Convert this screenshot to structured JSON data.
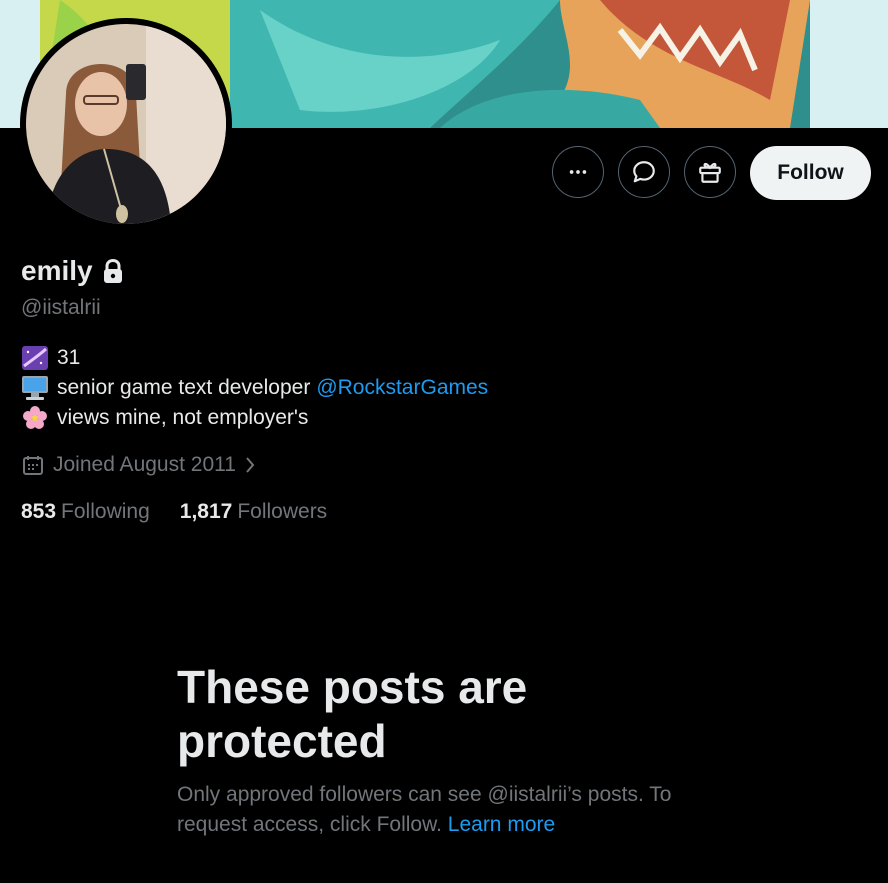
{
  "profile": {
    "display_name": "emily",
    "handle": "@iistalrii",
    "bio": {
      "line1_emoji": "milky-way-emoji",
      "line1_text": "31",
      "line2_emoji": "desktop-computer-emoji",
      "line2_text": "senior game text developer",
      "line2_mention": "@RockstarGames",
      "line3_emoji": "cherry-blossom-emoji",
      "line3_text": "views mine, not employer's"
    },
    "joined": "Joined August 2011",
    "following_count": "853",
    "following_label": "Following",
    "followers_count": "1,817",
    "followers_label": "Followers"
  },
  "actions": {
    "more_icon": "more-dots-icon",
    "message_icon": "message-bubble-icon",
    "gift_icon": "gift-icon",
    "follow_label": "Follow"
  },
  "protected": {
    "title": "These posts are protected",
    "body": "Only approved followers can see @iistalrii’s posts. To request access, click Follow.",
    "learn_more": "Learn more"
  },
  "colors": {
    "background": "#000000",
    "text_primary": "#e7e9ea",
    "text_secondary": "#71767b",
    "link": "#1d9bf0",
    "follow_button": "#eff3f4"
  }
}
